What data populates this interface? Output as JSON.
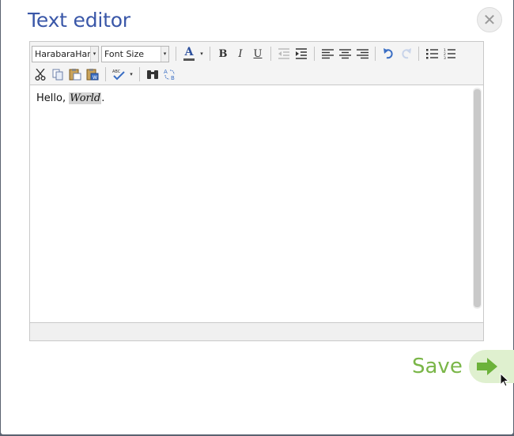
{
  "dialog": {
    "title": "Text editor",
    "close_glyph": "✕"
  },
  "toolbar": {
    "font_family": "HarabaraHand",
    "font_size": "Font Size",
    "combo_arrow": "▾",
    "font_color_label": "A",
    "bold_label": "B",
    "italic_label": "I",
    "underline_label": "U",
    "icons": {
      "align_left": "align-left-icon",
      "align_center": "align-center-icon",
      "align_right": "align-right-icon",
      "undo": "undo-icon",
      "redo": "redo-icon"
    }
  },
  "content": {
    "prefix": "Hello, ",
    "highlighted": "World",
    "suffix": "."
  },
  "footer": {
    "save_label": "Save"
  },
  "colors": {
    "title": "#3a57a8",
    "save": "#7ab648",
    "save_button_bg": "#dff0cf"
  }
}
